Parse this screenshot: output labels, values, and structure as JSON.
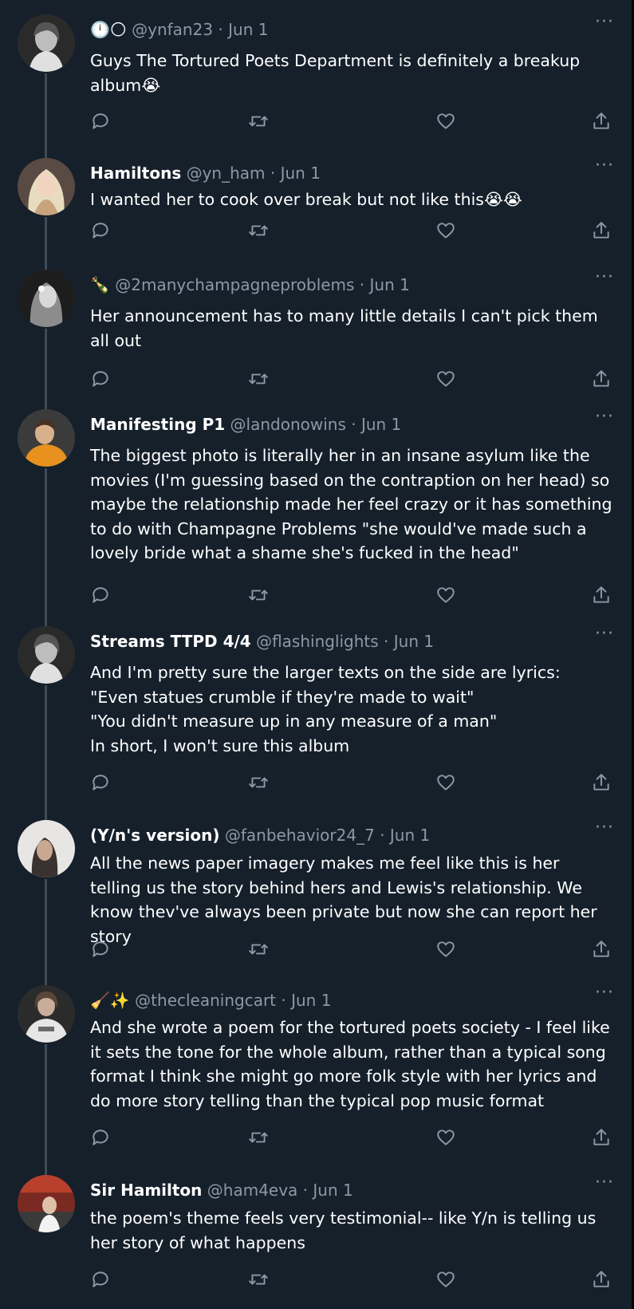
{
  "tweets": [
    {
      "prefix": "🕛🌕 ",
      "name": "",
      "handle": "@ynfan23",
      "date": "Jun 1",
      "text": "Guys The Tortured Poets Department is definitely a breakup album😭",
      "avatar": "avatar-bw-woman-icon"
    },
    {
      "prefix": "",
      "name": "Hamiltons",
      "handle": "@yn_ham",
      "date": "Jun 1",
      "text": "I wanted her to cook over break but not like this😭😭",
      "avatar": "avatar-blonde-woman-icon"
    },
    {
      "prefix": "🍾 ",
      "name": "",
      "handle": "@2manychampagneproblems",
      "date": "Jun 1",
      "text": "Her announcement has to many little details I can't pick them all out",
      "avatar": "avatar-bw-portrait-icon"
    },
    {
      "prefix": "",
      "name": "Manifesting P1",
      "handle": "@landonowins",
      "date": "Jun 1",
      "text": "The biggest photo is literally her in an insane asylum like the movies (I'm guessing based on the contraption on her head) so maybe the relationship made her feel crazy or it has something to do with Champagne Problems \"she would've made such a lovely bride what a shame she's fucked in the head\"",
      "avatar": "avatar-orange-jacket-icon"
    },
    {
      "prefix": "",
      "name": "Streams TTPD 4/4",
      "handle": "@flashinglights",
      "date": "Jun 1",
      "text": "And I'm pretty sure the larger texts on the side are lyrics:\n\"Even statues crumble if they're made to wait\"\n\"You didn't measure up in any measure of a man\"\nIn short, I won't sure this album",
      "avatar": "avatar-bw-woman-icon"
    },
    {
      "prefix": "",
      "name": "(Y/n's version)",
      "handle": "@fanbehavior24_7",
      "date": "Jun 1",
      "text": "All the news paper imagery makes me feel like this is her telling us the story behind hers and Lewis's relationship. We know thev've always been private but now she can report her story",
      "avatar": "avatar-light-portrait-icon"
    },
    {
      "prefix": "🧹✨ ",
      "name": "",
      "handle": "@thecleaningcart",
      "date": "Jun 1",
      "text": "And she wrote a poem for the tortured poets society - I feel like it sets the tone for the whole album, rather than a typical song format I think she might go more folk style with her lyrics and do more story telling than the typical pop music format",
      "avatar": "avatar-tshirt-icon"
    },
    {
      "prefix": "",
      "name": "Sir Hamilton",
      "handle": "@ham4eva",
      "date": "Jun 1",
      "text": "the poem's theme feels very testimonial-- like Y/n is telling us her story of what happens",
      "avatar": "avatar-street-icon"
    }
  ],
  "ui": {
    "separator": " · ",
    "more": "···"
  },
  "colors": {
    "background": "#15202b",
    "text": "#ffffff",
    "muted": "#8b98a5",
    "thread_line": "#3d4b57"
  }
}
